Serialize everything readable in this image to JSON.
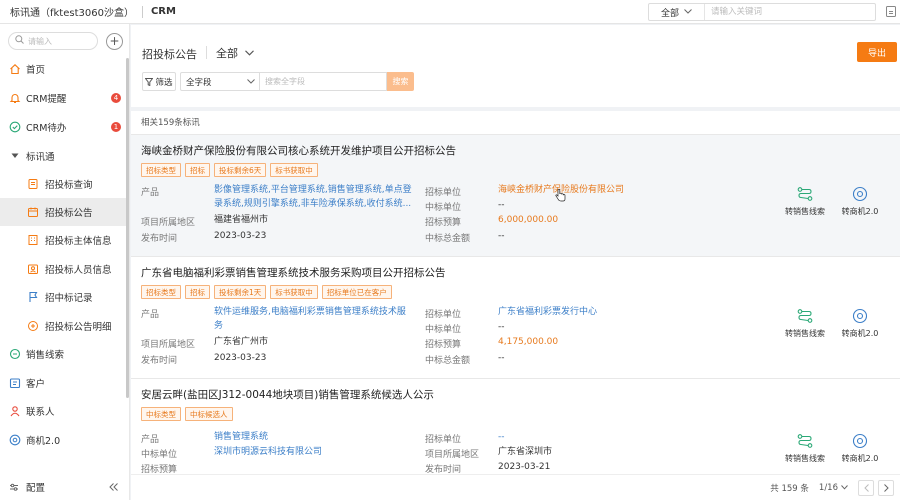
{
  "topbar": {
    "workspace_title": "标讯通（fktest3060沙盒）",
    "app_name": "CRM",
    "search_scope": "全部",
    "search_placeholder": "请输入关键词"
  },
  "sidebar": {
    "search_placeholder": "请输入",
    "items": [
      {
        "label": "首页",
        "icon": "home-icon"
      },
      {
        "label": "CRM提醒",
        "icon": "bell-icon",
        "badge": "4"
      },
      {
        "label": "CRM待办",
        "icon": "check-circle-icon",
        "badge": "1"
      },
      {
        "label": "标讯通",
        "icon": "caret-down-icon"
      },
      {
        "label": "招投标查询",
        "icon": "document-icon"
      },
      {
        "label": "招投标公告",
        "icon": "announcement-icon"
      },
      {
        "label": "招投标主体信息",
        "icon": "building-icon"
      },
      {
        "label": "招投标人员信息",
        "icon": "person-icon"
      },
      {
        "label": "招中标记录",
        "icon": "flag-icon"
      },
      {
        "label": "招投标公告明细",
        "icon": "detail-icon"
      },
      {
        "label": "销售线索",
        "icon": "leads-icon"
      },
      {
        "label": "客户",
        "icon": "customer-icon"
      },
      {
        "label": "联系人",
        "icon": "contact-icon"
      },
      {
        "label": "商机2.0",
        "icon": "opportunity-icon"
      }
    ],
    "footer_label": "配置"
  },
  "header": {
    "title": "招投标公告",
    "scope": "全部",
    "export_label": "导出",
    "filter_label": "筛选",
    "field_select": "全字段",
    "keyword_placeholder": "搜索全字段",
    "search_label": "搜索"
  },
  "results": {
    "count_text": "相关159条标讯",
    "cards": [
      {
        "title": "海峡金桥财产保险股份有限公司核心系统开发维护项目公开招标公告",
        "tags": [
          "招标类型",
          "招标",
          "投标剩余6天",
          "标书获取中"
        ],
        "product_label": "产品",
        "product_line1": "影像管理系统,平台管理系统,销售管理系统,单点登",
        "product_line2": "录系统,规则引擎系统,非车险承保系统,收付系统...",
        "region_label": "项目所属地区",
        "region": "福建省福州市",
        "date_label": "发布时间",
        "date": "2023-03-23",
        "tenderer_label": "招标单位",
        "tenderer": "海峡金桥财产保险股份有限公司",
        "winner_label": "中标单位",
        "winner": "--",
        "budget_label": "招标预算",
        "budget": "6,000,000.00",
        "amount_label": "中标总金额",
        "amount": "--",
        "action1": "转销售线索",
        "action2": "转商机2.0"
      },
      {
        "title": "广东省电脑福利彩票销售管理系统技术服务采购项目公开招标公告",
        "tags": [
          "招标类型",
          "招标",
          "投标剩余1天",
          "标书获取中",
          "招标单位已在客户"
        ],
        "product_label": "产品",
        "product_line1": "软件运维服务,电脑福利彩票销售管理系统技术服",
        "product_line2": "务",
        "region_label": "项目所属地区",
        "region": "广东省广州市",
        "date_label": "发布时间",
        "date": "2023-03-23",
        "tenderer_label": "招标单位",
        "tenderer": "广东省福利彩票发行中心",
        "winner_label": "中标单位",
        "winner": "--",
        "budget_label": "招标预算",
        "budget": "4,175,000.00",
        "amount_label": "中标总金额",
        "amount": "--",
        "action1": "转销售线索",
        "action2": "转商机2.0"
      },
      {
        "title": "安居云畔(盐田区J312-0044地块项目)销售管理系统候选人公示",
        "tags": [
          "中标类型",
          "中标候选人"
        ],
        "product_label": "产品",
        "product_line1": "销售管理系统",
        "winner_label": "中标单位",
        "winner": "深圳市明源云科技有限公司",
        "tenderer_label": "招标单位",
        "tenderer": "--",
        "region_label": "项目所属地区",
        "region": "广东省深圳市",
        "row3_left_label": "招标预算",
        "row3_right_label": "发布时间",
        "row3_right_value": "2023-03-21",
        "action1": "转销售线索",
        "action2": "转商机2.0"
      }
    ]
  },
  "pager": {
    "total_text": "共 159 条",
    "page_text": "1/16"
  }
}
